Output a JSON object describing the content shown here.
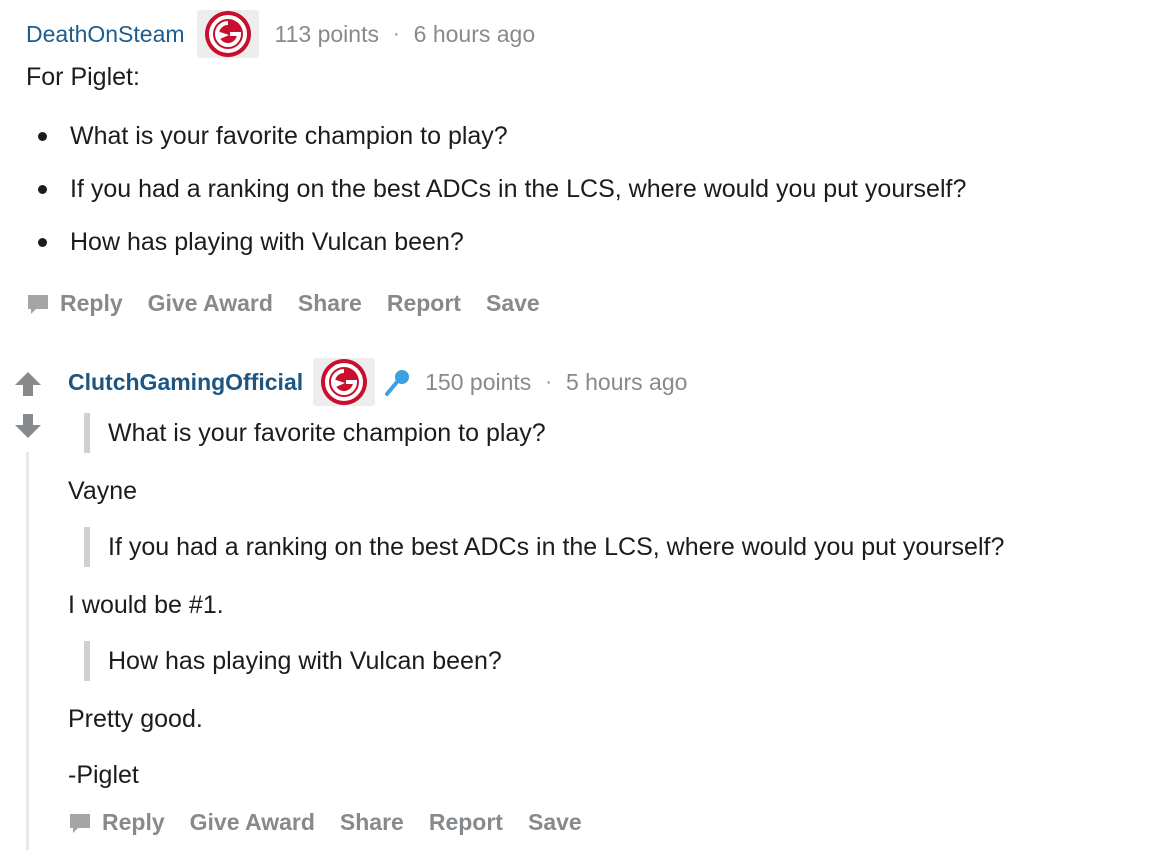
{
  "top_comment": {
    "author": "DeathOnSteam",
    "points": "113 points",
    "separator": "·",
    "time": "6 hours ago",
    "intro": "For Piglet:",
    "questions": [
      "What is your favorite champion to play?",
      "If you had a ranking on the best ADCs in the LCS, where would you put yourself?",
      "How has playing with Vulcan been?"
    ],
    "actions": {
      "reply": "Reply",
      "give_award": "Give Award",
      "share": "Share",
      "report": "Report",
      "save": "Save"
    }
  },
  "reply_comment": {
    "author": "ClutchGamingOfficial",
    "points": "150 points",
    "separator": "·",
    "time": "5 hours ago",
    "quote_1": "What is your favorite champion to play?",
    "answer_1": "Vayne",
    "quote_2": "If you had a ranking on the best ADCs in the LCS, where would you put yourself?",
    "answer_2": "I would be #1.",
    "quote_3": "How has playing with Vulcan been?",
    "answer_3": "Pretty good.",
    "signature": "-Piglet",
    "actions": {
      "reply": "Reply",
      "give_award": "Give Award",
      "share": "Share",
      "report": "Report",
      "save": "Save"
    }
  },
  "icons": {
    "flair": "clutch-gaming-logo-icon",
    "mic": "microphone-icon",
    "upvote": "upvote-arrow-icon",
    "downvote": "downvote-arrow-icon",
    "reply": "chat-bubble-icon"
  },
  "colors": {
    "brand_red": "#c8102e",
    "author_blue": "#1f5d8c",
    "muted": "#878a8c",
    "mic_blue": "#3ea0e0"
  }
}
